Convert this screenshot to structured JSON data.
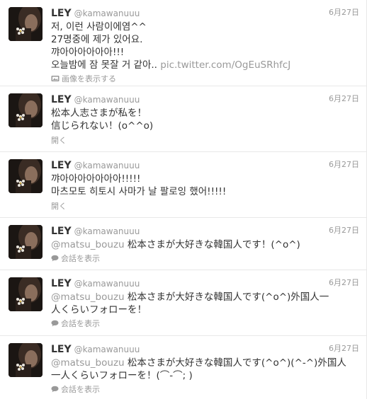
{
  "tweets": [
    {
      "fullname": "LEY",
      "username": "@kamawanuuu",
      "time": "6月27日",
      "lines": [
        "저, 이런 사람이에염^^",
        "27명중에 제가 있어요.",
        "꺄아아아아아아!!!"
      ],
      "last_line_text": "오늘밤에 잠 못잘 거 같아.. ",
      "link": "pic.twitter.com/OgEuSRhfcJ",
      "action": "画像を表示する",
      "action_icon": "image-icon"
    },
    {
      "fullname": "LEY",
      "username": "@kamawanuuu",
      "time": "6月27日",
      "lines": [
        "松本人志さまが私を！",
        "信じられない！(o^^o)"
      ],
      "action": "開く"
    },
    {
      "fullname": "LEY",
      "username": "@kamawanuuu",
      "time": "6月27日",
      "lines": [
        "꺄아아아아아아아!!!!!",
        "마츠모토 히토시 사마가 날 팔로잉 했어!!!!!"
      ],
      "action": "開く"
    },
    {
      "fullname": "LEY",
      "username": "@kamawanuuu",
      "time": "6月27日",
      "mention": "@matsu_bouzu",
      "lines": [
        " 松本さまが大好きな韓国人です！(^o^)"
      ],
      "action": "会話を表示",
      "action_icon": "conversation-icon"
    },
    {
      "fullname": "LEY",
      "username": "@kamawanuuu",
      "time": "6月27日",
      "mention": "@matsu_bouzu",
      "lines": [
        " 松本さまが大好きな韓国人です(^o^)外国人一",
        "人くらいフォローを！"
      ],
      "action": "会話を表示",
      "action_icon": "conversation-icon"
    },
    {
      "fullname": "LEY",
      "username": "@kamawanuuu",
      "time": "6月27日",
      "mention": "@matsu_bouzu",
      "lines": [
        " 松本さまが大好きな韓国人です(^o^)(^-^)外国人",
        "一人くらいフォローを！(⌒-⌒; )"
      ],
      "action": "会話を表示",
      "action_icon": "conversation-icon"
    }
  ]
}
